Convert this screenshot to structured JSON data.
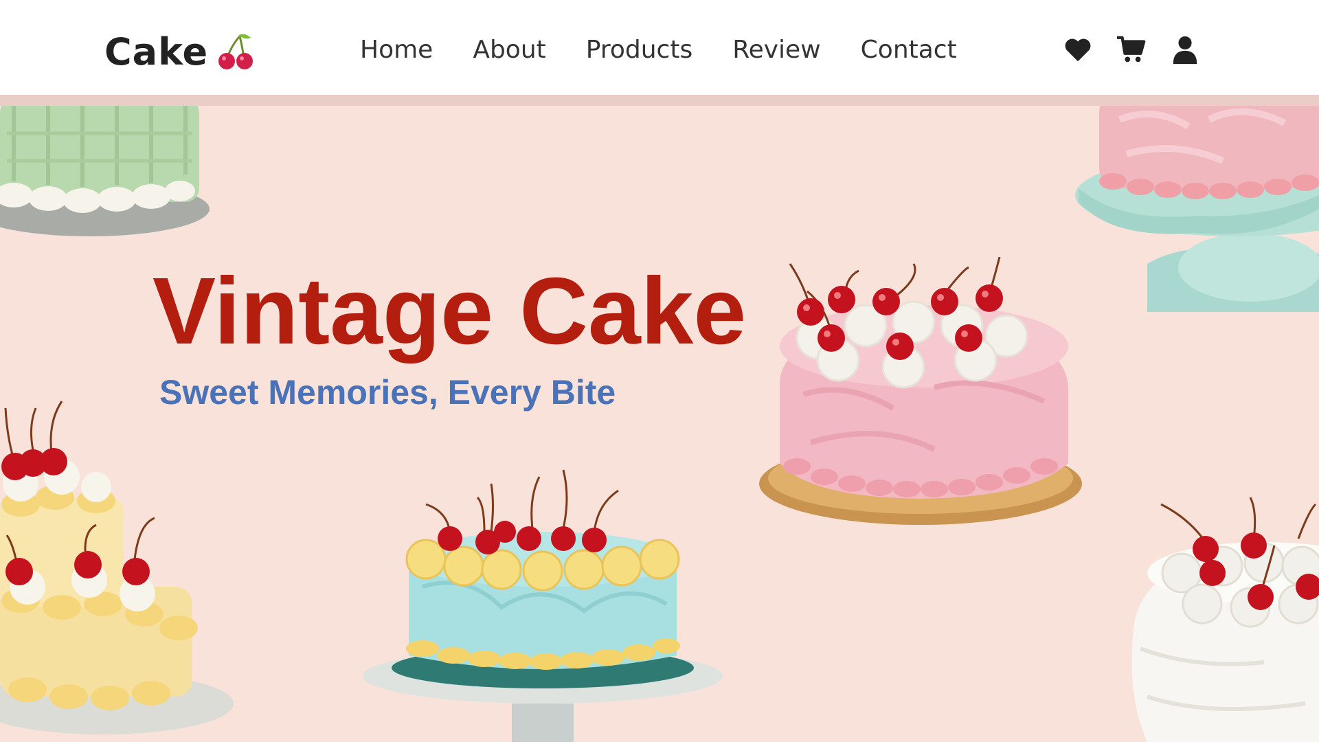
{
  "brand": {
    "name": "Cake",
    "icon": "cherry-icon"
  },
  "nav": {
    "links": [
      {
        "label": "Home"
      },
      {
        "label": "About"
      },
      {
        "label": "Products"
      },
      {
        "label": "Review"
      },
      {
        "label": "Contact"
      }
    ],
    "icons": [
      "heart-icon",
      "cart-icon",
      "user-icon"
    ]
  },
  "hero": {
    "title": "Vintage Cake",
    "subtitle": "Sweet Memories, Every Bite",
    "images": [
      "green-cake-image",
      "pink-cake-on-stand-image",
      "pink-cherry-cake-image",
      "yellow-tiered-cake-image",
      "blue-cherry-cake-image",
      "white-cherry-cake-image"
    ]
  },
  "colors": {
    "page_background": "#f9e2da",
    "navbar_background": "#ffffff",
    "title_red": "#b41e0f",
    "subtitle_blue": "#4a72b8",
    "cherry_red": "#c4121f"
  }
}
